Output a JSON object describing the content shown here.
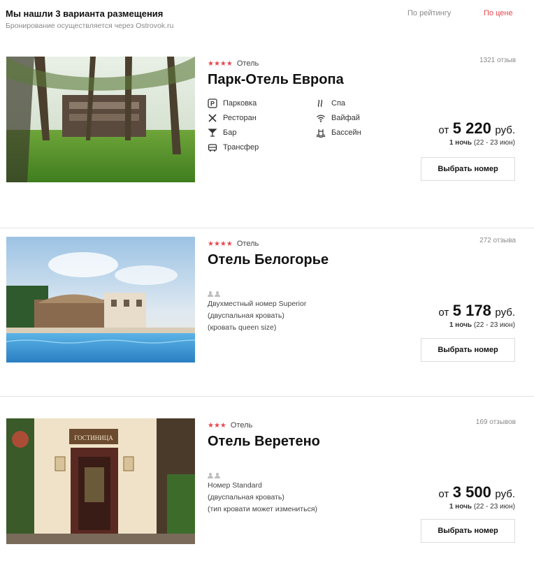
{
  "header": {
    "title": "Мы нашли 3 варианта размещения",
    "subtitle": "Бронирование осуществляется через Ostrovok.ru",
    "sort_rating": "По рейтингу",
    "sort_price": "По цене"
  },
  "colors": {
    "accent": "#e8474e",
    "muted": "#8a8a8a",
    "divider": "#e3e3e3"
  },
  "hotels": [
    {
      "stars": "★★★★",
      "type": "Отель",
      "name": "Парк-Отель Европа",
      "reviews": "1321 отзыв",
      "amenities": [
        {
          "icon": "parking-icon",
          "label": "Парковка"
        },
        {
          "icon": "restaurant-icon",
          "label": "Ресторан"
        },
        {
          "icon": "bar-icon",
          "label": "Бар"
        },
        {
          "icon": "transfer-icon",
          "label": "Трансфер"
        },
        {
          "icon": "spa-icon",
          "label": "Спа"
        },
        {
          "icon": "wifi-icon",
          "label": "Вайфай"
        },
        {
          "icon": "pool-icon",
          "label": "Бассейн"
        }
      ],
      "price_from": "от",
      "price_value": "5 220",
      "price_currency": "руб.",
      "nights_bold": "1 ночь",
      "nights_dates": "(22 - 23 июн)",
      "button": "Выбрать номер"
    },
    {
      "stars": "★★★★",
      "type": "Отель",
      "name": "Отель Белогорье",
      "reviews": "272 отзыва",
      "room": [
        "Двухместный номер Superior",
        "(двуспальная кровать)",
        "(кровать queen size)"
      ],
      "price_from": "от",
      "price_value": "5 178",
      "price_currency": "руб.",
      "nights_bold": "1 ночь",
      "nights_dates": "(22 - 23 июн)",
      "button": "Выбрать номер"
    },
    {
      "stars": "★★★",
      "type": "Отель",
      "name": "Отель Веретено",
      "reviews": "169 отзывов",
      "room": [
        "Номер Standard",
        "(двуспальная кровать)",
        "(тип кровати может измениться)"
      ],
      "sign": "ГОСТИНИЦА",
      "price_from": "от",
      "price_value": "3 500",
      "price_currency": "руб.",
      "nights_bold": "1 ночь",
      "nights_dates": "(22 - 23 июн)",
      "button": "Выбрать номер"
    }
  ]
}
